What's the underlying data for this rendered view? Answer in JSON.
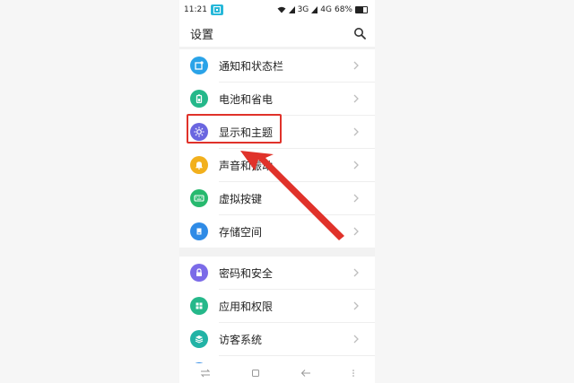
{
  "status_bar": {
    "time": "11:21",
    "network": "3G",
    "network2": "4G",
    "battery": "68%"
  },
  "header": {
    "title": "设置",
    "search_icon": "search-icon"
  },
  "group1": [
    {
      "label": "通知和状态栏",
      "icon": "notification-icon",
      "color": "#2aa3e8"
    },
    {
      "label": "电池和省电",
      "icon": "battery-icon",
      "color": "#25b88a"
    },
    {
      "label": "显示和主题",
      "icon": "sun-icon",
      "color": "#6a66e0"
    },
    {
      "label": "声音和振动",
      "icon": "bell-icon",
      "color": "#f2b01d"
    },
    {
      "label": "虚拟按键",
      "icon": "keyboard-icon",
      "color": "#27b96e"
    },
    {
      "label": "存储空间",
      "icon": "storage-icon",
      "color": "#2f8be6"
    }
  ],
  "group2": [
    {
      "label": "密码和安全",
      "icon": "lock-icon",
      "color": "#7b6be8"
    },
    {
      "label": "应用和权限",
      "icon": "apps-icon",
      "color": "#25b88a"
    },
    {
      "label": "访客系统",
      "icon": "guest-icon",
      "color": "#22b3a6"
    }
  ],
  "colors": {
    "highlight": "#e0322a",
    "arrow": "#e0322a"
  }
}
